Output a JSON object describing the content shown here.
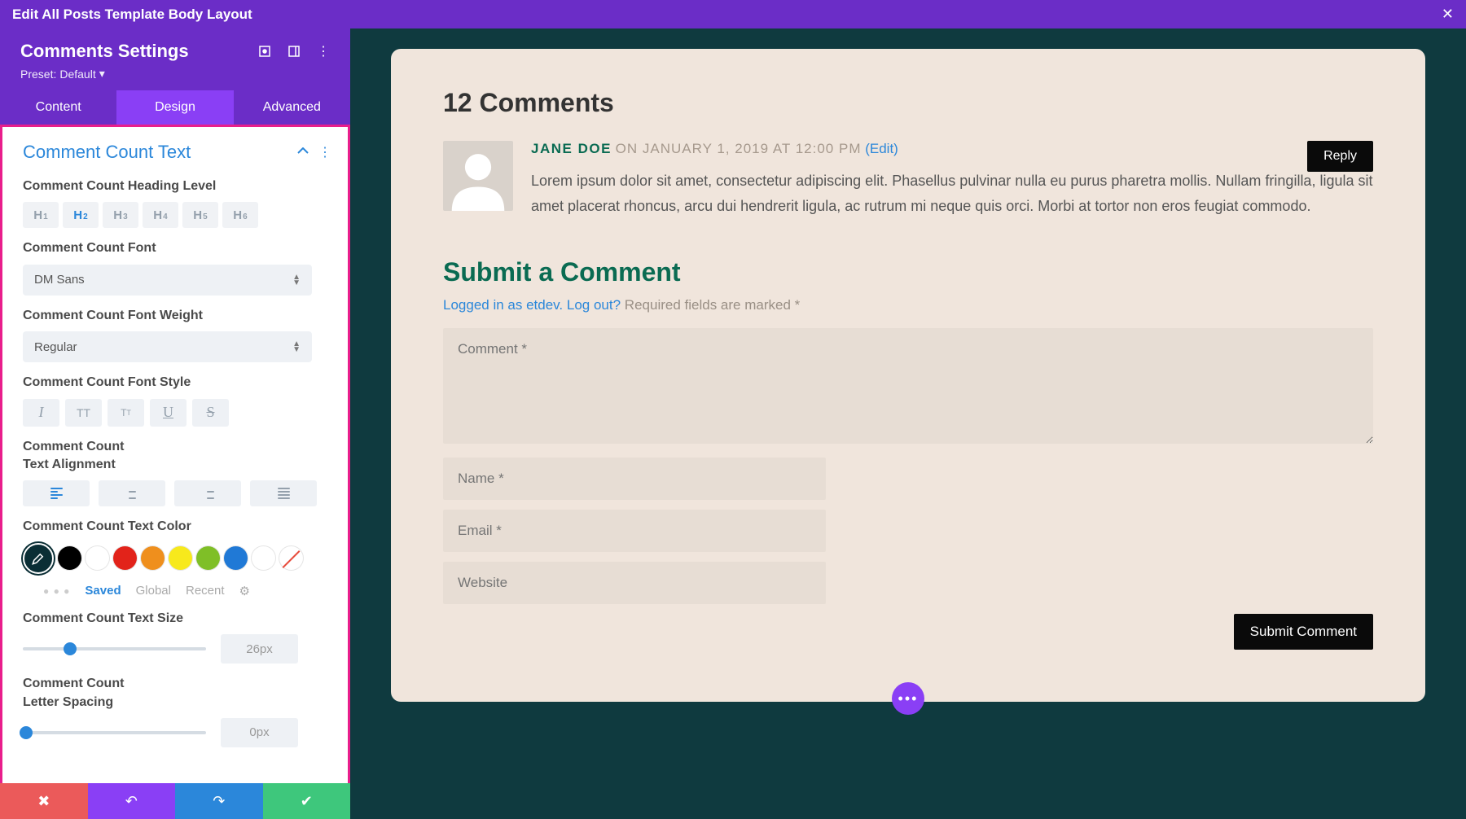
{
  "topbar": {
    "title": "Edit All Posts Template Body Layout"
  },
  "sidebar": {
    "title": "Comments Settings",
    "preset_label": "Preset:",
    "preset_value": "Default",
    "tabs": {
      "content": "Content",
      "design": "Design",
      "advanced": "Advanced"
    }
  },
  "section": {
    "title": "Comment Count Text",
    "heading_level_label": "Comment Count Heading Level",
    "font_label": "Comment Count Font",
    "font_value": "DM Sans",
    "weight_label": "Comment Count Font Weight",
    "weight_value": "Regular",
    "style_label": "Comment Count Font Style",
    "align_label": "Comment Count Text Alignment",
    "color_label": "Comment Count Text Color",
    "color_tabs": {
      "saved": "Saved",
      "global": "Global",
      "recent": "Recent"
    },
    "size_label": "Comment Count Text Size",
    "size_value": "26px",
    "spacing_label": "Comment Count Letter Spacing",
    "spacing_value": "0px"
  },
  "heading_levels": [
    "H1",
    "H2",
    "H3",
    "H4",
    "H5",
    "H6"
  ],
  "colors": {
    "swatches": [
      "#000000",
      "#ffffff",
      "#e2231a",
      "#ef8f1d",
      "#f7e91c",
      "#7fbf27",
      "#2079d6",
      "#ffffff"
    ]
  },
  "preview": {
    "count_title": "12 Comments",
    "author": "JANE DOE",
    "date": "ON JANUARY 1, 2019 AT 12:00 PM",
    "edit": "(Edit)",
    "body": "Lorem ipsum dolor sit amet, consectetur adipiscing elit. Phasellus pulvinar nulla eu purus pharetra mollis. Nullam fringilla, ligula sit amet placerat rhoncus, arcu dui hendrerit ligula, ac rutrum mi neque quis orci. Morbi at tortor non eros feugiat commodo.",
    "reply": "Reply",
    "form_title": "Submit a Comment",
    "logged_in": "Logged in as etdev.",
    "logout": "Log out?",
    "required": "Required fields are marked *",
    "ph_comment": "Comment *",
    "ph_name": "Name *",
    "ph_email": "Email *",
    "ph_website": "Website",
    "submit": "Submit Comment"
  }
}
